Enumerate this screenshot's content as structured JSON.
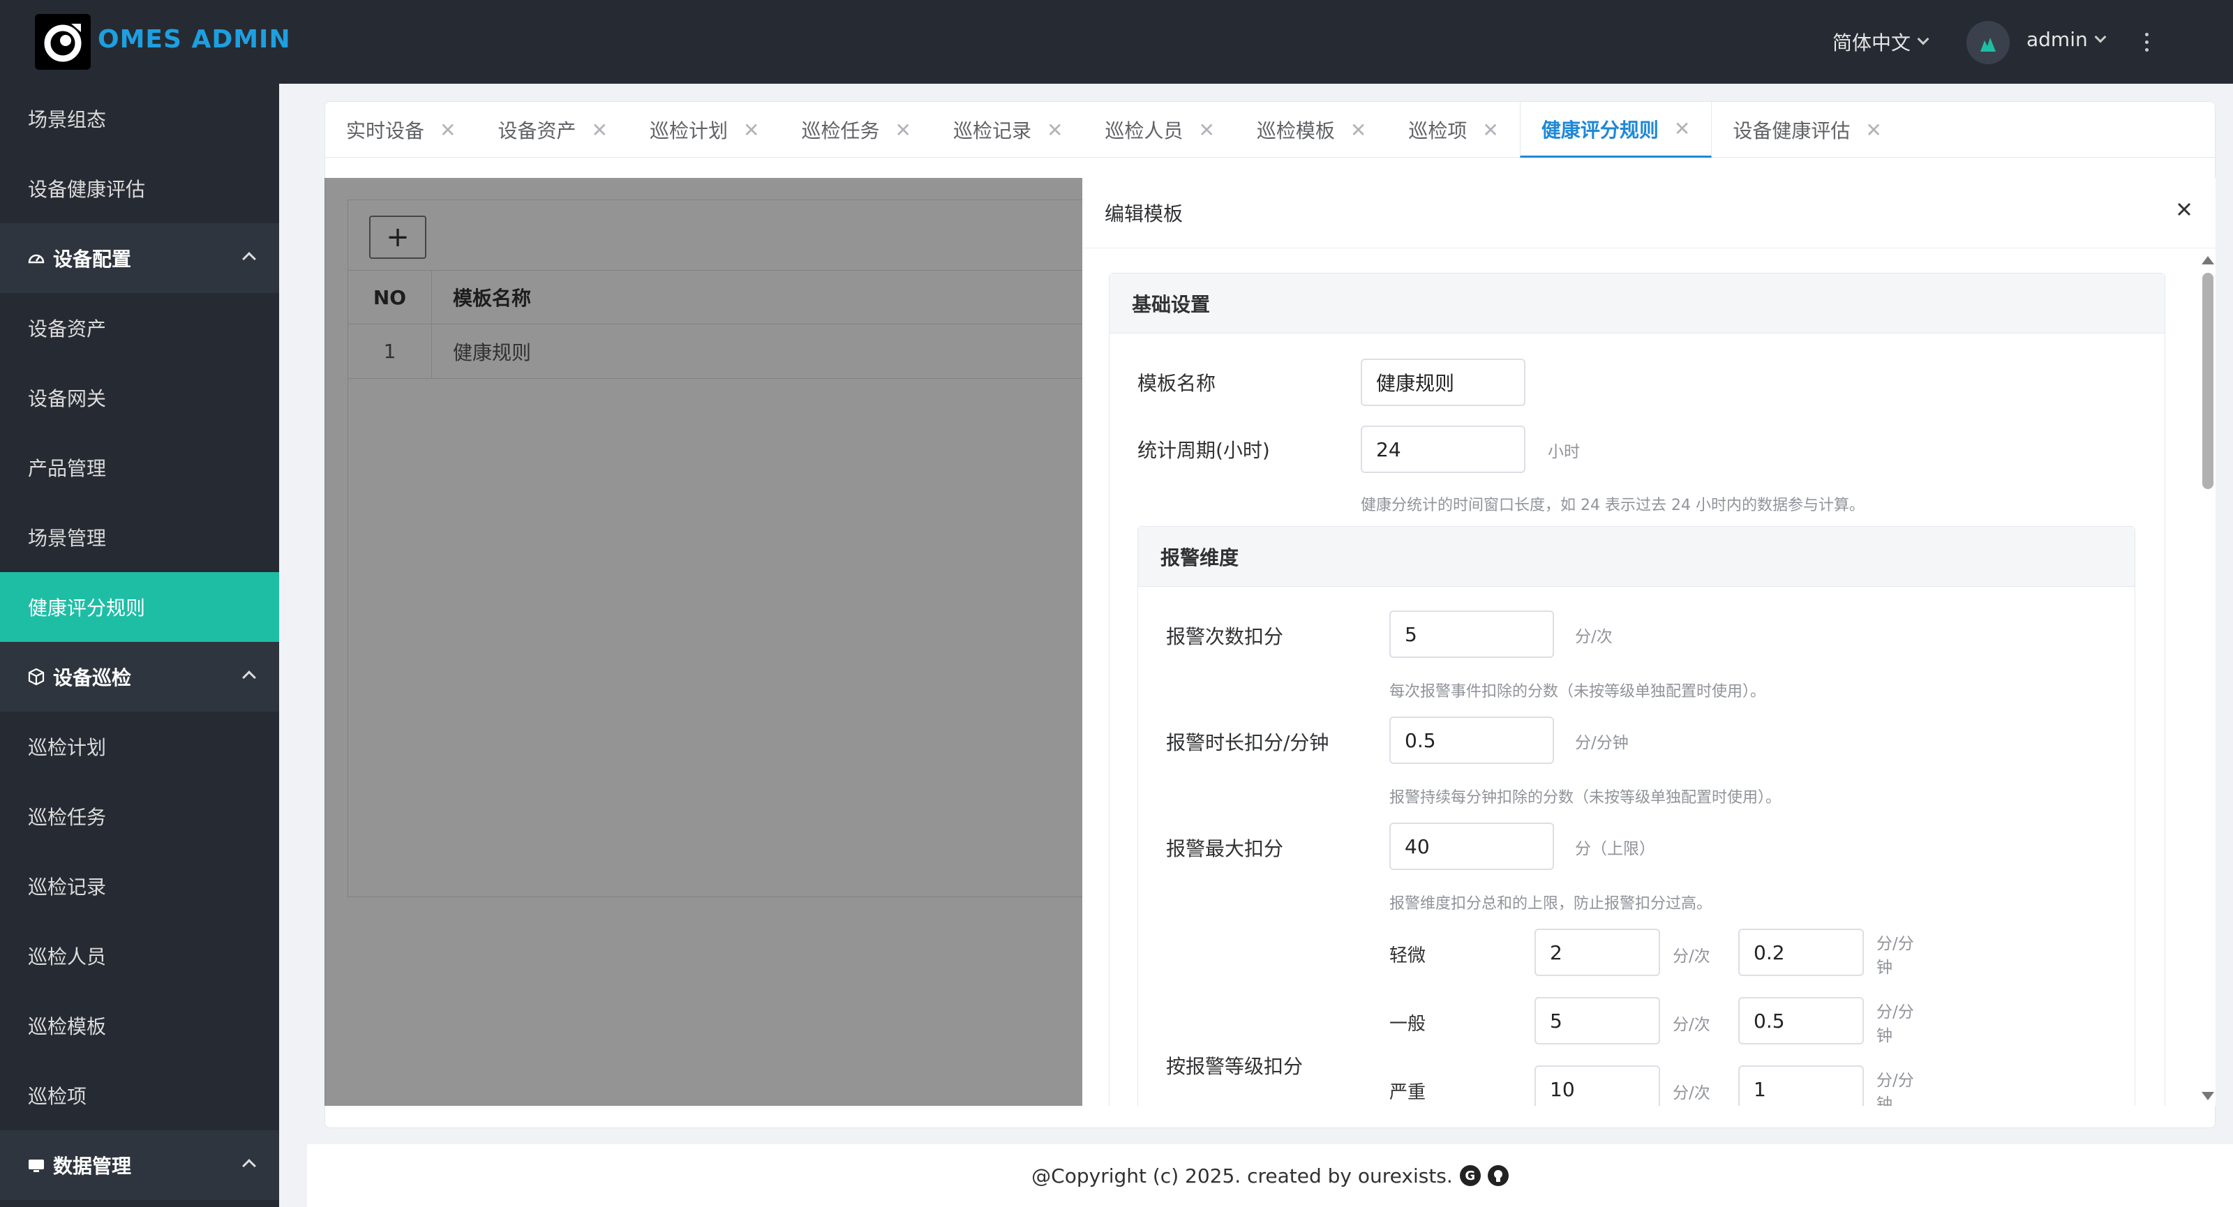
{
  "header": {
    "logo_text": "OMES ADMIN",
    "language": "简体中文",
    "username": "admin"
  },
  "sidebar": {
    "items": [
      {
        "label": "场景组态",
        "type": "item"
      },
      {
        "label": "设备健康评估",
        "type": "item"
      },
      {
        "label": "设备配置",
        "type": "group",
        "icon": "gauge-icon"
      },
      {
        "label": "设备资产",
        "type": "item"
      },
      {
        "label": "设备网关",
        "type": "item"
      },
      {
        "label": "产品管理",
        "type": "item"
      },
      {
        "label": "场景管理",
        "type": "item"
      },
      {
        "label": "健康评分规则",
        "type": "item",
        "active": true
      },
      {
        "label": "设备巡检",
        "type": "group",
        "icon": "box-icon"
      },
      {
        "label": "巡检计划",
        "type": "item"
      },
      {
        "label": "巡检任务",
        "type": "item"
      },
      {
        "label": "巡检记录",
        "type": "item"
      },
      {
        "label": "巡检人员",
        "type": "item"
      },
      {
        "label": "巡检模板",
        "type": "item"
      },
      {
        "label": "巡检项",
        "type": "item"
      },
      {
        "label": "数据管理",
        "type": "group",
        "icon": "monitor-icon"
      }
    ]
  },
  "tabs": [
    {
      "label": "实时设备"
    },
    {
      "label": "设备资产"
    },
    {
      "label": "巡检计划"
    },
    {
      "label": "巡检任务"
    },
    {
      "label": "巡检记录"
    },
    {
      "label": "巡检人员"
    },
    {
      "label": "巡检模板"
    },
    {
      "label": "巡检项"
    },
    {
      "label": "健康评分规则",
      "active": true
    },
    {
      "label": "设备健康评估",
      "closable": false
    }
  ],
  "list": {
    "add_label": "+",
    "columns": [
      "NO",
      "模板名称"
    ],
    "rows": [
      [
        "1",
        "健康规则"
      ]
    ]
  },
  "drawer": {
    "title": "编辑模板",
    "basic_section": "基础设置",
    "template_name_label": "模板名称",
    "template_name_value": "健康规则",
    "period_label": "统计周期(小时)",
    "period_value": "24",
    "period_unit": "小时",
    "period_hint": "健康分统计的时间窗口长度，如 24 表示过去 24 小时内的数据参与计算。",
    "alarm_section": "报警维度",
    "alarm_count_label": "报警次数扣分",
    "alarm_count_value": "5",
    "alarm_count_unit": "分/次",
    "alarm_count_hint": "每次报警事件扣除的分数（未按等级单独配置时使用）。",
    "alarm_duration_label": "报警时长扣分/分钟",
    "alarm_duration_value": "0.5",
    "alarm_duration_unit": "分/分钟",
    "alarm_duration_hint": "报警持续每分钟扣除的分数（未按等级单独配置时使用）。",
    "alarm_max_label": "报警最大扣分",
    "alarm_max_value": "40",
    "alarm_max_unit": "分（上限）",
    "alarm_max_hint": "报警维度扣分总和的上限，防止报警扣分过高。",
    "level_label": "按报警等级扣分",
    "levels": [
      {
        "name": "轻微",
        "count": "2",
        "count_unit": "分/次",
        "minute": "0.2",
        "minute_unit_1": "分/分",
        "minute_unit_2": "钟"
      },
      {
        "name": "一般",
        "count": "5",
        "count_unit": "分/次",
        "minute": "0.5",
        "minute_unit_1": "分/分",
        "minute_unit_2": "钟"
      },
      {
        "name": "严重",
        "count": "10",
        "count_unit": "分/次",
        "minute": "1",
        "minute_unit_1": "分/分",
        "minute_unit_2": "钟"
      }
    ]
  },
  "footer": {
    "text": "@Copyright (c) 2025. created by ourexists."
  },
  "colors": {
    "header_bg": "#262b33",
    "accent": "#1ebea5",
    "tab_active": "#1e88d6",
    "logo_text": "#1e9fe0"
  }
}
